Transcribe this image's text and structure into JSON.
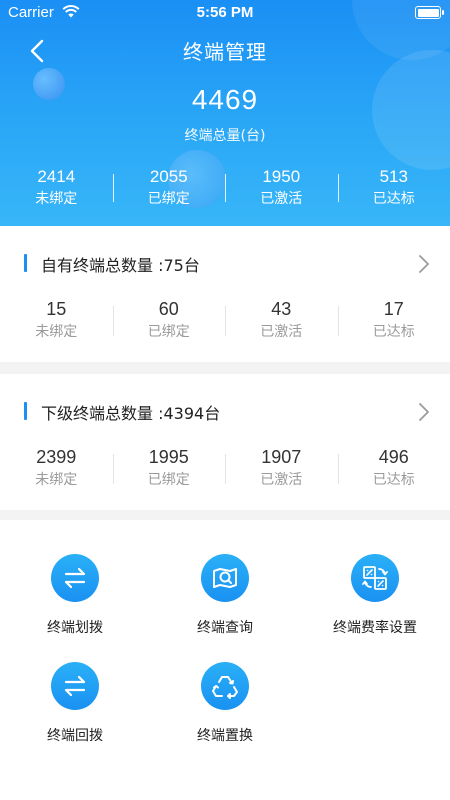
{
  "status_bar": {
    "carrier": "Carrier",
    "time": "5:56 PM"
  },
  "header": {
    "title": "终端管理",
    "total": "4469",
    "total_label": "终端总量(台)",
    "stats": [
      {
        "value": "2414",
        "label": "未绑定"
      },
      {
        "value": "2055",
        "label": "已绑定"
      },
      {
        "value": "1950",
        "label": "已激活"
      },
      {
        "value": "513",
        "label": "已达标"
      }
    ]
  },
  "own": {
    "title": "自有终端总数量 :75台",
    "stats": [
      {
        "value": "15",
        "label": "未绑定"
      },
      {
        "value": "60",
        "label": "已绑定"
      },
      {
        "value": "43",
        "label": "已激活"
      },
      {
        "value": "17",
        "label": "已达标"
      }
    ]
  },
  "sub": {
    "title": "下级终端总数量 :4394台",
    "stats": [
      {
        "value": "2399",
        "label": "未绑定"
      },
      {
        "value": "1995",
        "label": "已绑定"
      },
      {
        "value": "1907",
        "label": "已激活"
      },
      {
        "value": "496",
        "label": "已达标"
      }
    ]
  },
  "actions": [
    {
      "label": "终端划拨",
      "icon": "transfer-icon"
    },
    {
      "label": "终端查询",
      "icon": "map-search-icon"
    },
    {
      "label": "终端费率设置",
      "icon": "rate-exchange-icon"
    },
    {
      "label": "终端回拨",
      "icon": "return-transfer-icon"
    },
    {
      "label": "终端置换",
      "icon": "recycle-icon"
    }
  ],
  "colors": {
    "primary": "#1a8ff5",
    "header_end": "#38b6f8",
    "muted": "#9a9a9a"
  }
}
